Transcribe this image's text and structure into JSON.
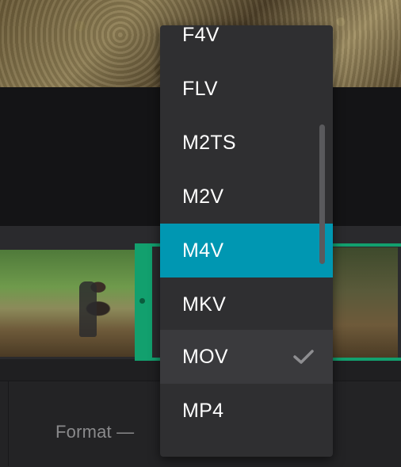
{
  "format_panel": {
    "label": "Format —"
  },
  "dropdown": {
    "options": [
      {
        "label": "F4V",
        "state": "normal"
      },
      {
        "label": "FLV",
        "state": "normal"
      },
      {
        "label": "M2TS",
        "state": "normal"
      },
      {
        "label": "M2V",
        "state": "normal"
      },
      {
        "label": "M4V",
        "state": "highlighted"
      },
      {
        "label": "MKV",
        "state": "normal"
      },
      {
        "label": "MOV",
        "state": "selected"
      },
      {
        "label": "MP4",
        "state": "normal"
      }
    ],
    "selected_value": "MOV",
    "highlighted_value": "M4V"
  },
  "colors": {
    "accent_highlight": "#0097b2",
    "selection_frame": "#12a06e",
    "menu_background": "#2f2f31",
    "menu_text": "#ffffff"
  },
  "icons": {
    "selected_marker": "checkmark-icon"
  }
}
